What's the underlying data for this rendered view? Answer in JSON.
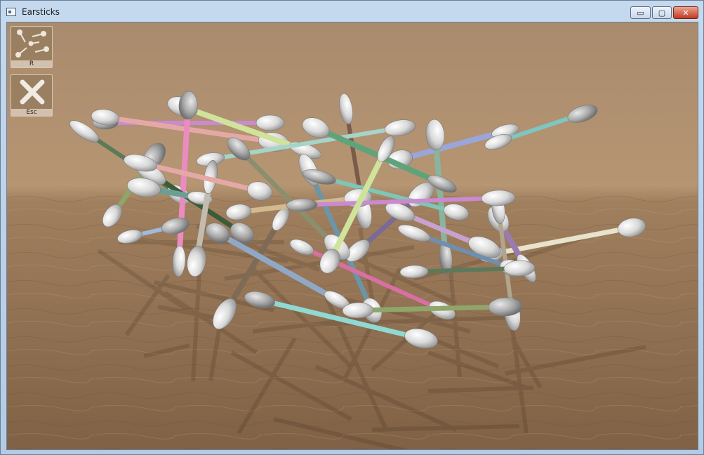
{
  "window": {
    "title": "Earsticks"
  },
  "window_controls": {
    "minimize": "▭",
    "maximize": "▢",
    "close": "✕"
  },
  "hud": {
    "rearrange": {
      "key_label": "R",
      "icon": "scatter-arrows-icon"
    },
    "exit": {
      "key_label": "Esc",
      "icon": "x-icon"
    }
  },
  "scene": {
    "description_icon": "earstick-pile",
    "colors": {
      "bg_top": "#b0916f",
      "floor": "#8a6a4a",
      "swab": "#e6e6e6"
    },
    "sticks": [
      {
        "c": "#c98ad0"
      },
      {
        "c": "#e4a9a6"
      },
      {
        "c": "#cfe39a"
      },
      {
        "c": "#5b7a5a"
      },
      {
        "c": "#8fa56a"
      },
      {
        "c": "#ea8cc0"
      },
      {
        "c": "#7a5b4a"
      },
      {
        "c": "#6b95a8"
      },
      {
        "c": "#9aa6d8"
      },
      {
        "c": "#7fc6c0"
      },
      {
        "c": "#8fd9d2"
      },
      {
        "c": "#7f6a55"
      },
      {
        "c": "#d96fa2"
      },
      {
        "c": "#7a6a98"
      },
      {
        "c": "#89b49d"
      },
      {
        "c": "#7ec6b7"
      },
      {
        "c": "#e8e3cc"
      },
      {
        "c": "#9a7bb0"
      },
      {
        "c": "#b2a58e"
      },
      {
        "c": "#3d5a3a"
      },
      {
        "c": "#90a8c6"
      },
      {
        "c": "#a6d4c8"
      },
      {
        "c": "#c7a2cf"
      },
      {
        "c": "#6aa093"
      },
      {
        "c": "#a0b9dd"
      },
      {
        "c": "#8b8f70"
      },
      {
        "c": "#c2bcb0"
      },
      {
        "c": "#6f8fb0"
      },
      {
        "c": "#d4b98e"
      },
      {
        "c": "#5fa37b"
      }
    ]
  }
}
